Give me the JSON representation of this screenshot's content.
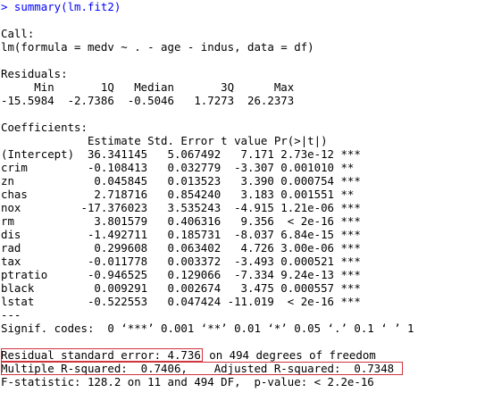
{
  "console": {
    "prompt": "> ",
    "command": "summary(lm.fit2)",
    "call_header": "Call:",
    "call_formula": "lm(formula = medv ~ . - age - indus, data = df)",
    "residuals_header": "Residuals:",
    "residuals_labels": "     Min       1Q   Median       3Q      Max ",
    "residuals_values": "-15.5984  -2.7386  -0.5046   1.7273  26.2373 ",
    "coefficients_header": "Coefficients:",
    "coef_columns": "             Estimate Std. Error t value Pr(>|t|)    ",
    "coef_rows": [
      "(Intercept)  36.341145   5.067492   7.171 2.73e-12 ***",
      "crim         -0.108413   0.032779  -3.307 0.001010 ** ",
      "zn            0.045845   0.013523   3.390 0.000754 ***",
      "chas          2.718716   0.854240   3.183 0.001551 ** ",
      "nox         -17.376023   3.535243  -4.915 1.21e-06 ***",
      "rm            3.801579   0.406316   9.356  < 2e-16 ***",
      "dis          -1.492711   0.185731  -8.037 6.84e-15 ***",
      "rad           0.299608   0.063402   4.726 3.00e-06 ***",
      "tax          -0.011778   0.003372  -3.493 0.000521 ***",
      "ptratio      -0.946525   0.129066  -7.334 9.24e-13 ***",
      "black         0.009291   0.002674   3.475 0.000557 ***",
      "lstat        -0.522553   0.047424 -11.019  < 2e-16 ***"
    ],
    "separator": "---",
    "signif_codes": "Signif. codes:  0 ‘***’ 0.001 ‘**’ 0.01 ‘*’ 0.05 ‘.’ 0.1 ‘ ’ 1",
    "rse_boxed": "Residual standard error: 4.736",
    "rse_rest": " on 494 degrees of freedom",
    "rsq_boxed": "Multiple R-squared:  0.7406,\tAdjusted R-squared:  0.7348 ",
    "fstat": "F-statistic: 128.2 on 11 and 494 DF,  p-value: < 2.2e-16"
  },
  "colors": {
    "command": "#0000ff",
    "output": "#000000",
    "highlight_box": "#d0343c"
  }
}
